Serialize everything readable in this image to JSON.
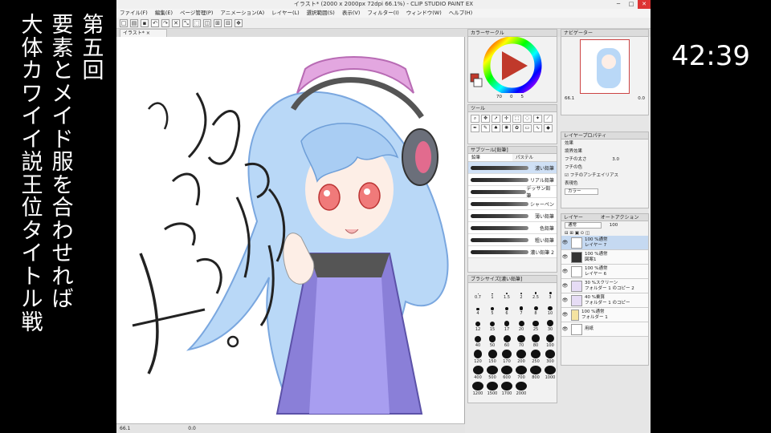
{
  "overlay": {
    "title_columns": [
      "第五回",
      "要素とメイド服を合わせれば",
      "大体カワイイ説王位タイトル戦"
    ],
    "timer": "42:39"
  },
  "window": {
    "title": "イラスト* (2000 x 2000px 72dpi 66.1%) - CLIP STUDIO PAINT EX",
    "buttons": [
      "─",
      "□",
      "✕"
    ]
  },
  "menu": [
    "ファイル(F)",
    "編集(E)",
    "ページ管理(P)",
    "アニメーション(A)",
    "レイヤー(L)",
    "選択範囲(S)",
    "表示(V)",
    "フィルター(I)",
    "ウィンドウ(W)",
    "ヘルプ(H)"
  ],
  "document_tab": "イラスト*",
  "status": {
    "zoom": "66.1",
    "angle": "0.0"
  },
  "color_panel": {
    "title": "カラーサークル",
    "values": [
      "70",
      "0",
      "5"
    ],
    "accent": "#c0392b"
  },
  "navigator": {
    "title": "ナビゲーター",
    "zoom": "66.1",
    "angle": "0.0"
  },
  "tool_panel": {
    "title": "ツール"
  },
  "sub_tool": {
    "title": "サブツール[鉛筆]",
    "tabs": [
      "鉛筆",
      "パステル"
    ],
    "brushes": [
      {
        "name": "濃い鉛筆",
        "selected": true
      },
      {
        "name": "リアル鉛筆",
        "selected": false
      },
      {
        "name": "デッサン鉛筆",
        "selected": false
      },
      {
        "name": "シャーペン",
        "selected": false
      },
      {
        "name": "薄い鉛筆",
        "selected": false
      },
      {
        "name": "色鉛筆",
        "selected": false
      },
      {
        "name": "粗い鉛筆",
        "selected": false
      },
      {
        "name": "濃い鉛筆 2",
        "selected": false
      }
    ]
  },
  "brush_size": {
    "title": "ブラシサイズ[濃い鉛筆]",
    "sizes": [
      "0.7",
      "1",
      "1.5",
      "2",
      "2.5",
      "3",
      "4",
      "5",
      "6",
      "7",
      "8",
      "10",
      "12",
      "15",
      "17",
      "20",
      "25",
      "30",
      "40",
      "50",
      "60",
      "70",
      "80",
      "100",
      "120",
      "150",
      "170",
      "200",
      "250",
      "300",
      "400",
      "500",
      "600",
      "700",
      "800",
      "1000",
      "1200",
      "1500",
      "1700",
      "2000"
    ]
  },
  "layer_property": {
    "title": "レイヤープロパティ",
    "effect_label": "効果",
    "border_effect": "境界効果",
    "border_width": "フチの太さ",
    "border_value": "3.0",
    "border_color": "フチの色",
    "antialias": "フチのアンチエイリアス",
    "expression_color": "表現色",
    "expression_value": "カラー"
  },
  "layers_panel": {
    "title": "レイヤー",
    "tab2": "オートアクション",
    "blend_mode": "通常",
    "opacity": "100",
    "layers": [
      {
        "line1": "100 %通常",
        "line2": "レイヤー 7",
        "selected": true
      },
      {
        "line1": "100 %通常",
        "line2": "図案1",
        "selected": false
      },
      {
        "line1": "100 %通常",
        "line2": "レイヤー 6",
        "selected": false
      },
      {
        "line1": "30 %スクリーン",
        "line2": "フォルダー 1 のコピー 2",
        "selected": false
      },
      {
        "line1": "40 %乗算",
        "line2": "フォルダー 1 のコピー",
        "selected": false
      },
      {
        "line1": "100 %通常",
        "line2": "フォルダー 1",
        "selected": false
      },
      {
        "line1": "",
        "line2": "用紙",
        "selected": false
      }
    ]
  }
}
